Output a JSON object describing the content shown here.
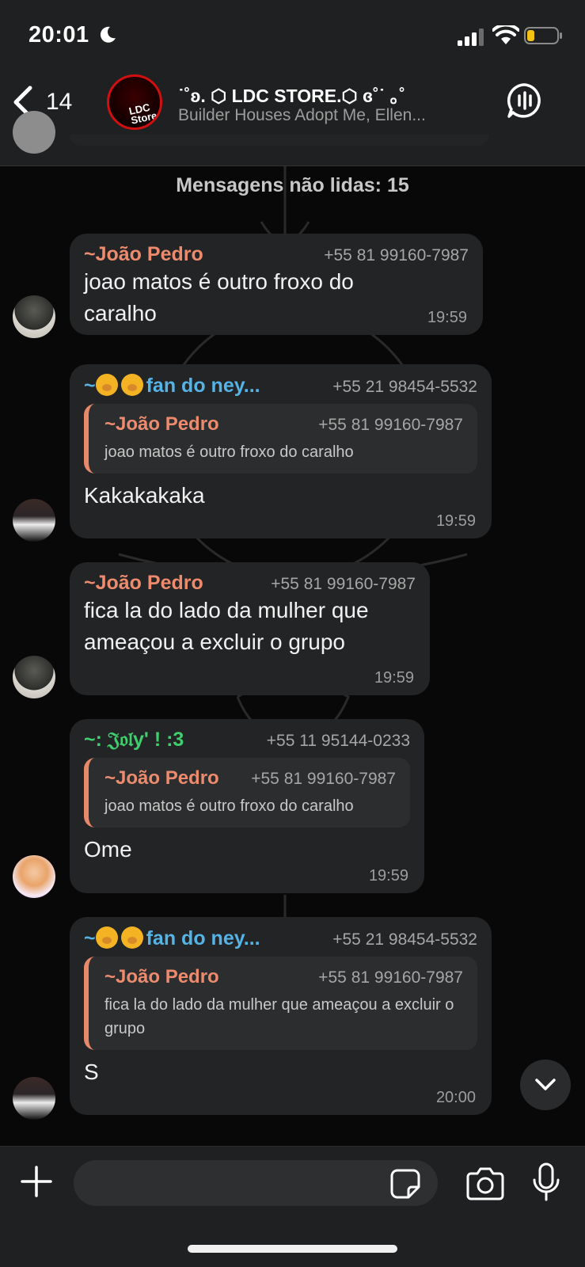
{
  "status_bar": {
    "time": "20:01",
    "icons": [
      "moon-icon",
      "signal-icon",
      "wifi-icon",
      "battery-icon"
    ]
  },
  "header": {
    "back_count": "14",
    "title": "˙˚ʚ. ⬡ LDC STORE.⬡ ɞ˚˙ ｡˚",
    "subtitle": "Builder Houses Adopt Me, Ellen...",
    "avatar_logo": "LDC Store"
  },
  "unread_divider": "Mensagens não lidas: 15",
  "messages": [
    {
      "sender": "~João Pedro",
      "phone": "+55 81 99160-7987",
      "text": "joao matos é outro froxo do caralho",
      "time": "19:59"
    },
    {
      "sender": "fan do ney...",
      "sender_prefix": "~",
      "phone": "+55 21 98454-5532",
      "quote_sender": "~João Pedro",
      "quote_phone": "+55 81 99160-7987",
      "quote_text": "joao matos é outro froxo do caralho",
      "text": "Kakakakaka",
      "time": "19:59"
    },
    {
      "sender": "~João Pedro",
      "phone": "+55 81 99160-7987",
      "text": "fica la do lado da mulher que ameaçou a excluir o grupo",
      "time": "19:59"
    },
    {
      "sender": "~: 𝔍𝔬𝔩y' ! :3",
      "phone": "+55 11 95144-0233",
      "quote_sender": "~João Pedro",
      "quote_phone": "+55 81 99160-7987",
      "quote_text": "joao matos é outro froxo do caralho",
      "text": "Ome",
      "time": "19:59"
    },
    {
      "sender": "fan do ney...",
      "sender_prefix": "~",
      "phone": "+55 21 98454-5532",
      "quote_sender": "~João Pedro",
      "quote_phone": "+55 81 99160-7987",
      "quote_text": "fica la do lado da mulher que ameaçou a excluir o grupo",
      "text": "S",
      "time": "20:00"
    }
  ],
  "input": {
    "placeholder": ""
  },
  "colors": {
    "joao": "#ec8b6d",
    "ney": "#55b3e6",
    "joly": "#3ecf6e",
    "bubble": "#232425",
    "bar": "#1f2021"
  }
}
